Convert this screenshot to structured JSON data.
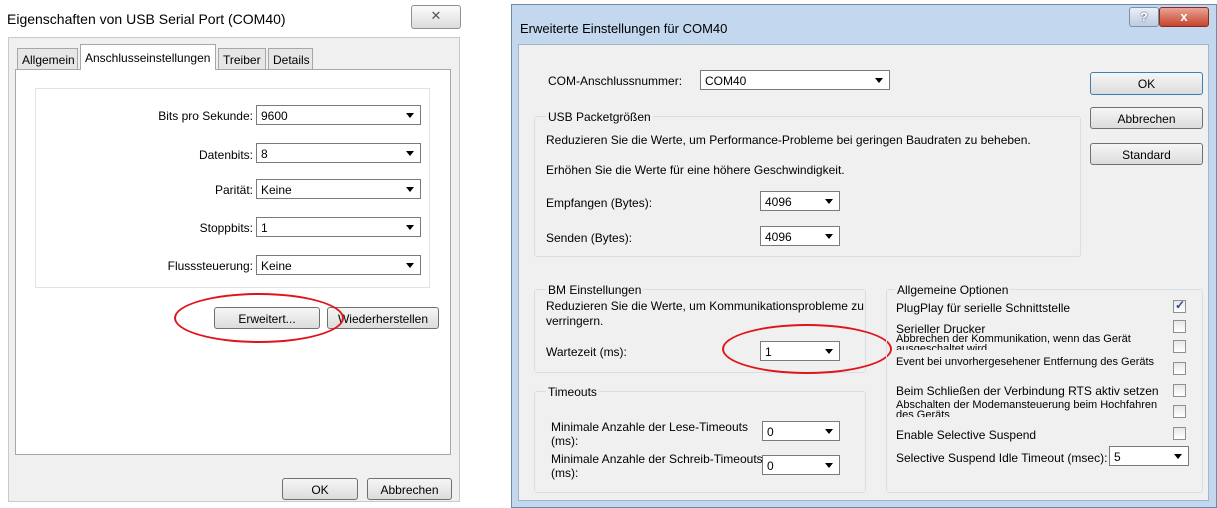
{
  "left_dialog": {
    "title": "Eigenschaften von USB Serial Port (COM40)",
    "close_glyph": "✕",
    "tabs": [
      "Allgemein",
      "Anschlusseinstellungen",
      "Treiber",
      "Details"
    ],
    "active_tab": "Anschlusseinstellungen",
    "fields": [
      {
        "label": "Bits pro Sekunde:",
        "value": "9600"
      },
      {
        "label": "Datenbits:",
        "value": "8"
      },
      {
        "label": "Parität:",
        "value": "Keine"
      },
      {
        "label": "Stoppbits:",
        "value": "1"
      },
      {
        "label": "Flusssteuerung:",
        "value": "Keine"
      }
    ],
    "advanced_button": "Erweitert...",
    "restore_button": "Wiederherstellen",
    "ok_button": "OK",
    "cancel_button": "Abbrechen"
  },
  "right_dialog": {
    "title": "Erweiterte Einstellungen für COM40",
    "help_glyph": "?",
    "close_glyph": "x",
    "com_label": "COM-Anschlussnummer:",
    "com_value": "COM40",
    "ok_button": "OK",
    "cancel_button": "Abbrechen",
    "default_button": "Standard",
    "usb": {
      "legend": "USB Packetgrößen",
      "line1": "Reduzieren Sie die Werte, um Performance-Probleme bei geringen Baudraten zu beheben.",
      "line2": "Erhöhen Sie die Werte für eine höhere Geschwindigkeit.",
      "receive_label": "Empfangen (Bytes):",
      "receive_value": "4096",
      "send_label": "Senden (Bytes):",
      "send_value": "4096"
    },
    "bm": {
      "legend": "BM Einstellungen",
      "line1": "Reduzieren Sie die Werte, um Kommunikationsprobleme zu",
      "line2": "verringern.",
      "latency_label": "Wartezeit (ms):",
      "latency_value": "1"
    },
    "timeouts": {
      "legend": "Timeouts",
      "read_label_1": "Minimale Anzahle der Lese-Timeouts",
      "read_label_2": "(ms):",
      "read_value": "0",
      "write_label_1": "Minimale Anzahle der Schreib-Timeouts",
      "write_label_2": "(ms):",
      "write_value": "0"
    },
    "general": {
      "legend": "Allgemeine Optionen",
      "options": [
        {
          "label": "PlugPlay für serielle Schnittstelle",
          "checked": true
        },
        {
          "label": "Serieller Drucker",
          "checked": false
        },
        {
          "label": "Abbrechen der Kommunikation, wenn das Gerät ausgeschaltet wird",
          "checked": false
        },
        {
          "label": "Event bei unvorhergesehener Entfernung des Geräts",
          "checked": false
        },
        {
          "label": "Beim Schließen der Verbindung RTS aktiv setzen",
          "checked": false
        },
        {
          "label": "Abschalten der Modemansteuerung beim Hochfahren des Geräts",
          "checked": false
        },
        {
          "label": "Enable Selective Suspend",
          "checked": false
        }
      ],
      "suspend_label": "Selective Suspend Idle Timeout (msec):",
      "suspend_value": "5"
    }
  },
  "annotation_color": "#e0141b"
}
